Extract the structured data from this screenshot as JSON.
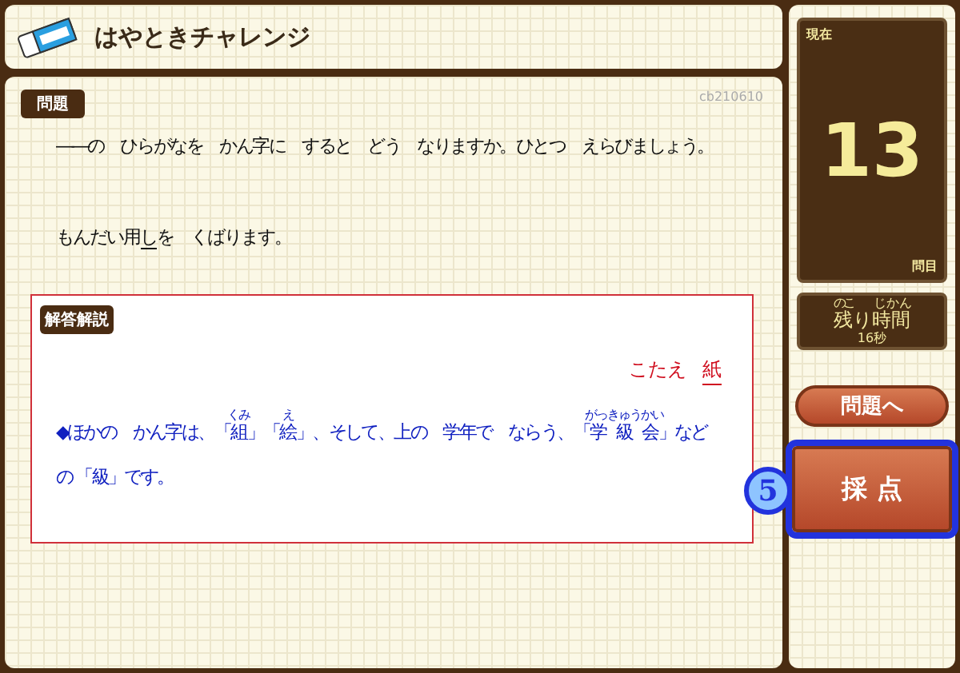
{
  "header": {
    "title": "はやときチャレンジ"
  },
  "question": {
    "label": "問題",
    "code": "cb210610",
    "prompt": "――の　ひらがなを　かん字に　すると　どう　なりますか。ひとつ　えらびましょう。",
    "sentence": [
      {
        "text": "もんだい用",
        "underlined": false
      },
      {
        "text": "し",
        "underlined": true
      },
      {
        "text": "を　くばります。",
        "underlined": false
      }
    ]
  },
  "explanation": {
    "label": "解答解説",
    "answer_label": "こたえ",
    "answer": "紙",
    "lines": [
      [
        {
          "text": "◆ほかの　かん字は、「"
        },
        {
          "text": "組",
          "ruby": "くみ"
        },
        {
          "text": "」「"
        },
        {
          "text": "絵",
          "ruby": "え"
        },
        {
          "text": "」、そして、上の　学年で　ならう、「"
        },
        {
          "text": "学級会",
          "ruby": "がっきゅうかい"
        },
        {
          "text": "」など"
        }
      ],
      [
        {
          "text": "の 「級」です。"
        }
      ]
    ]
  },
  "status": {
    "current_label": "現在",
    "number": "13",
    "unit": "問目",
    "remaining_label": [
      {
        "text": "残",
        "ruby": "のこ"
      },
      {
        "text": "り"
      },
      {
        "text": "時間",
        "ruby": "じかん"
      }
    ],
    "remaining": "16秒"
  },
  "buttons": [
    {
      "label": "問題へ",
      "kind": "next"
    },
    {
      "label": "採 点",
      "kind": "grade",
      "highlighted": true,
      "step": "5"
    }
  ]
}
